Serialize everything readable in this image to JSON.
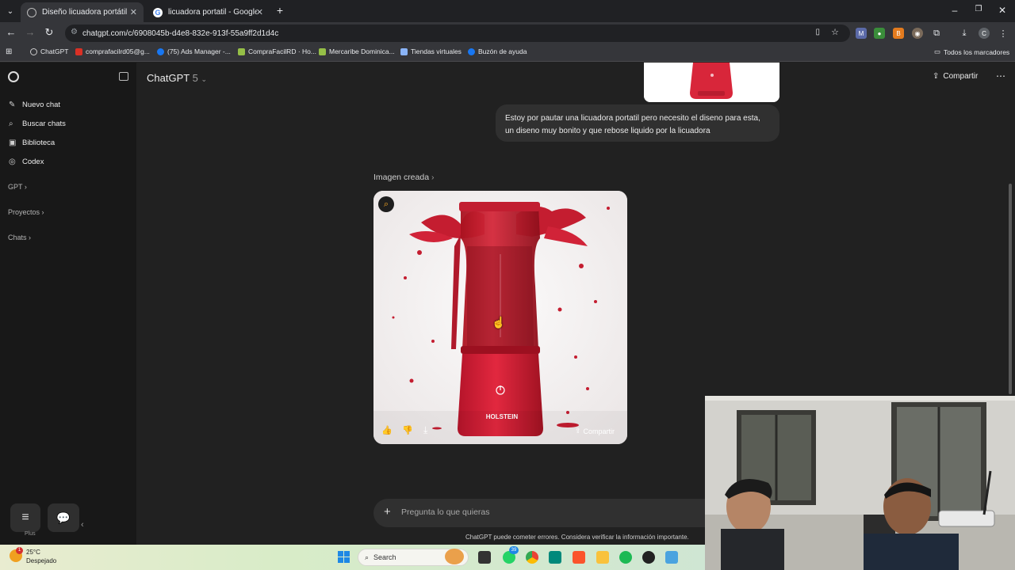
{
  "browser": {
    "tabs": [
      {
        "title": "Diseño licuadora portátil",
        "active": true
      },
      {
        "title": "licuadora portatil - Google Sear",
        "active": false
      }
    ],
    "url": "chatgpt.com/c/6908045b-d4e8-832e-913f-55a9ff2d1d4c",
    "bookmarks": [
      "ChatGPT",
      "comprafacilrd05@g...",
      "(75) Ads Manager -...",
      "CompraFacilRD · Ho...",
      "Mercaribe Dominica...",
      "Tiendas virtuales",
      "Buzón de ayuda"
    ],
    "bookmarks_all": "Todos los marcadores"
  },
  "sidebar": {
    "items": [
      {
        "label": "Nuevo chat",
        "icon": "pencil-square-icon"
      },
      {
        "label": "Buscar chats",
        "icon": "search-icon"
      },
      {
        "label": "Biblioteca",
        "icon": "library-icon"
      },
      {
        "label": "Codex",
        "icon": "codex-icon"
      }
    ],
    "sections": [
      "GPT",
      "Proyectos",
      "Chats"
    ],
    "plan": "Plus"
  },
  "header": {
    "title": "ChatGPT",
    "model": "5",
    "share": "Compartir"
  },
  "conversation": {
    "user_message": "Estoy por pautar una licuadora portatil pero necesito el diseno para esta, un diseno muy bonito   y que rebose liquido por la licuadora",
    "image_label": "Imagen creada",
    "image_brand": "HOLSTEIN",
    "image_share": "Compartir"
  },
  "composer": {
    "placeholder": "Pregunta lo que quieras"
  },
  "disclaimer": "ChatGPT puede cometer errores. Considera verificar la información importante.",
  "taskbar": {
    "weather_temp": "25°C",
    "weather_desc": "Despejado",
    "search": "Search",
    "badge_notif": "1",
    "badge_whatsapp": "39"
  }
}
